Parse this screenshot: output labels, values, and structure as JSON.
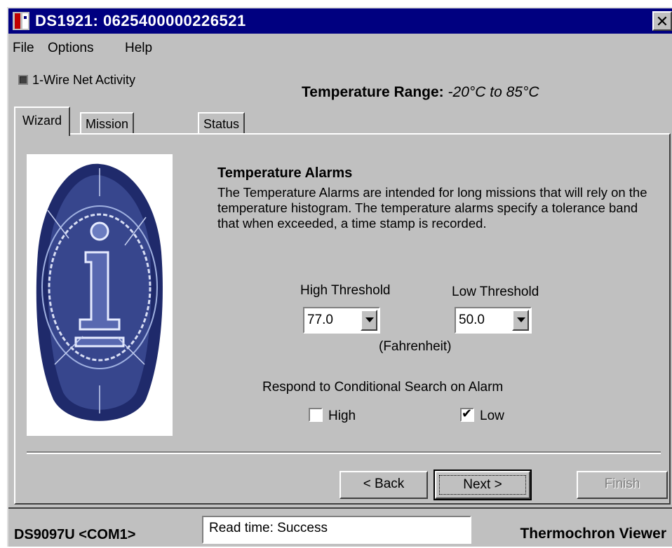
{
  "window": {
    "title": "DS1921:  0625400000226521",
    "close_glyph": "✕"
  },
  "menu": {
    "file": "File",
    "options": "Options",
    "help": "Help"
  },
  "activity_label": "1-Wire Net Activity",
  "temp_range": {
    "label": "Temperature Range:",
    "value": "-20°C to 85°C"
  },
  "tabs": [
    {
      "label": "Wizard",
      "active": true
    },
    {
      "label": "Mission Results",
      "active": false
    },
    {
      "label": "Status",
      "active": false
    }
  ],
  "wizard": {
    "heading": "Temperature Alarms",
    "description": "The Temperature Alarms are intended for long missions that will rely on the temperature histogram.  The temperature alarms specify a tolerance band that when exceeded, a time stamp is recorded.",
    "high_label": "High Threshold",
    "low_label": "Low Threshold",
    "high_value": "77.0",
    "low_value": "50.0",
    "unit": "(Fahrenheit)",
    "respond_label": "Respond to Conditional Search on Alarm",
    "high_check_label": "High",
    "low_check_label": "Low",
    "high_checked": false,
    "low_checked": true
  },
  "buttons": {
    "back": "< Back",
    "next": "Next >",
    "finish": "Finish"
  },
  "status": {
    "adapter": "DS9097U <COM1>",
    "message": "Read time: Success",
    "app_name": "Thermochron Viewer"
  },
  "colors": {
    "titlebar": "#000080",
    "face": "#c0c0c0"
  }
}
